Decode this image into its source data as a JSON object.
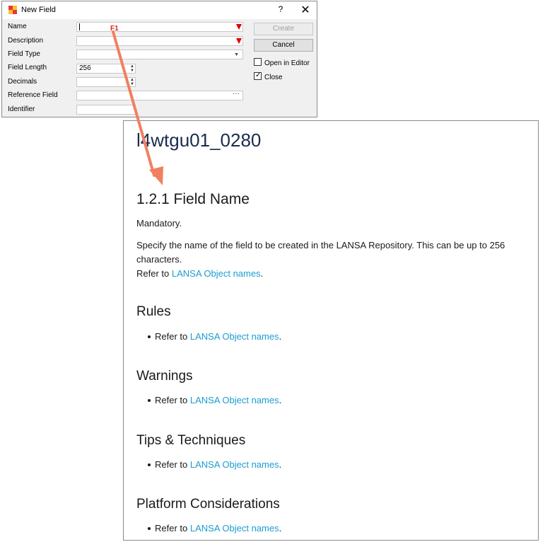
{
  "dialog": {
    "title": "New Field",
    "help_glyph": "?",
    "close_glyph": "✕",
    "fields": {
      "name": {
        "label": "Name",
        "value": ""
      },
      "description": {
        "label": "Description",
        "value": ""
      },
      "field_type": {
        "label": "Field Type",
        "value": ""
      },
      "field_length": {
        "label": "Field Length",
        "value": "256"
      },
      "decimals": {
        "label": "Decimals",
        "value": ""
      },
      "reference_field": {
        "label": "Reference Field",
        "value": ""
      },
      "identifier": {
        "label": "Identifier",
        "value": ""
      }
    },
    "buttons": {
      "create": "Create",
      "cancel": "Cancel"
    },
    "checkboxes": {
      "open_in_editor": {
        "label": "Open in Editor",
        "checked": false
      },
      "close": {
        "label": "Close",
        "checked": true
      }
    },
    "mandatory_color": "#e00000"
  },
  "annotation": {
    "key_label": "F1",
    "color": "#f08060"
  },
  "help": {
    "title": "l4wtgu01_0280",
    "heading": "1.2.1 Field Name",
    "mandatory": "Mandatory.",
    "desc_line1": "Specify the name of the field to be created in the LANSA Repository. This can be up to 256",
    "desc_line2": "characters.",
    "refer_prefix": "Refer to ",
    "link_text": "LANSA Object names",
    "period": ".",
    "sections": {
      "rules": "Rules",
      "warnings": "Warnings",
      "tips": "Tips & Techniques",
      "platform": "Platform Considerations"
    },
    "link_color": "#1a9dd0"
  }
}
